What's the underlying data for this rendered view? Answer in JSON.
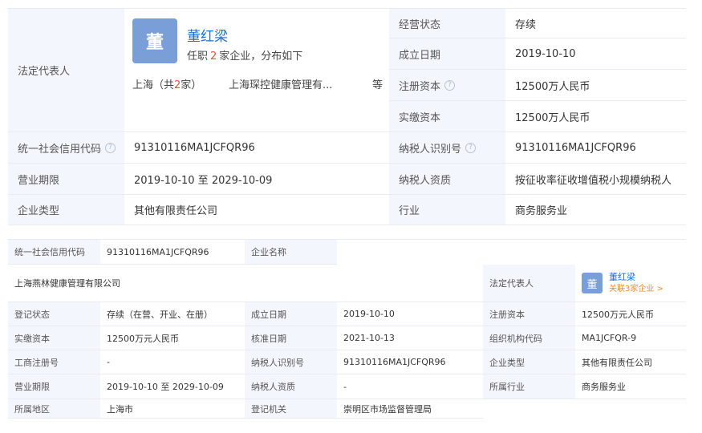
{
  "top": {
    "legal_rep_label": "法定代表人",
    "avatar_char": "董",
    "name": "董红梁",
    "posts_prefix": "任职",
    "posts_count": "2",
    "posts_suffix": "家企业，分布如下",
    "region_prefix": "上海（共",
    "region_count": "2",
    "region_suffix": "家）",
    "company": "上海琛控健康管理有...",
    "more": "等",
    "status_label": "经营状态",
    "status_value": "存续",
    "est_date_label": "成立日期",
    "est_date_value": "2019-10-10",
    "reg_capital_label": "注册资本",
    "reg_capital_value": "12500万人民币",
    "paid_capital_label": "实缴资本",
    "paid_capital_value": "12500万人民币",
    "credit_code_label": "统一社会信用代码",
    "credit_code_value": "91310116MA1JCFQR96",
    "taxpayer_id_label": "纳税人识别号",
    "taxpayer_id_value": "91310116MA1JCFQR96",
    "term_label": "营业期限",
    "term_value": "2019-10-10 至 2029-10-09",
    "taxpayer_qual_label": "纳税人资质",
    "taxpayer_qual_value": "按征收率征收增值税小规模纳税人",
    "type_label": "企业类型",
    "type_value": "其他有限责任公司",
    "industry_label": "行业",
    "industry_value": "商务服务业"
  },
  "bottom": {
    "credit_code_label": "统一社会信用代码",
    "credit_code_value": "91310116MA1JCFQR96",
    "name_label": "企业名称",
    "name_value": "上海燕林健康管理有限公司",
    "legal_rep_label": "法定代表人",
    "avatar_char": "董",
    "rep_name": "董红梁",
    "rep_link": "关联3家企业 >",
    "reg_status_label": "登记状态",
    "reg_status_value": "存续（在营、开业、在册）",
    "est_date_label": "成立日期",
    "est_date_value": "2019-10-10",
    "reg_capital_label": "注册资本",
    "reg_capital_value": "12500万元人民币",
    "paid_capital_label": "实缴资本",
    "paid_capital_value": "12500万元人民币",
    "approve_date_label": "核准日期",
    "approve_date_value": "2021-10-13",
    "org_code_label": "组织机构代码",
    "org_code_value": "MA1JCFQR-9",
    "biz_reg_no_label": "工商注册号",
    "biz_reg_no_value": "-",
    "taxpayer_id_label": "纳税人识别号",
    "taxpayer_id_value": "91310116MA1JCFQR96",
    "type_label": "企业类型",
    "type_value": "其他有限责任公司",
    "term_label": "营业期限",
    "term_value": "2019-10-10 至 2029-10-09",
    "taxpayer_qual_label": "纳税人资质",
    "taxpayer_qual_value": "-",
    "industry_label": "所属行业",
    "industry_value": "商务服务业",
    "region_label": "所属地区",
    "region_value": "上海市",
    "authority_label": "登记机关",
    "authority_value": "崇明区市场监督管理局"
  },
  "icons": {
    "info": "info-circle-icon"
  }
}
